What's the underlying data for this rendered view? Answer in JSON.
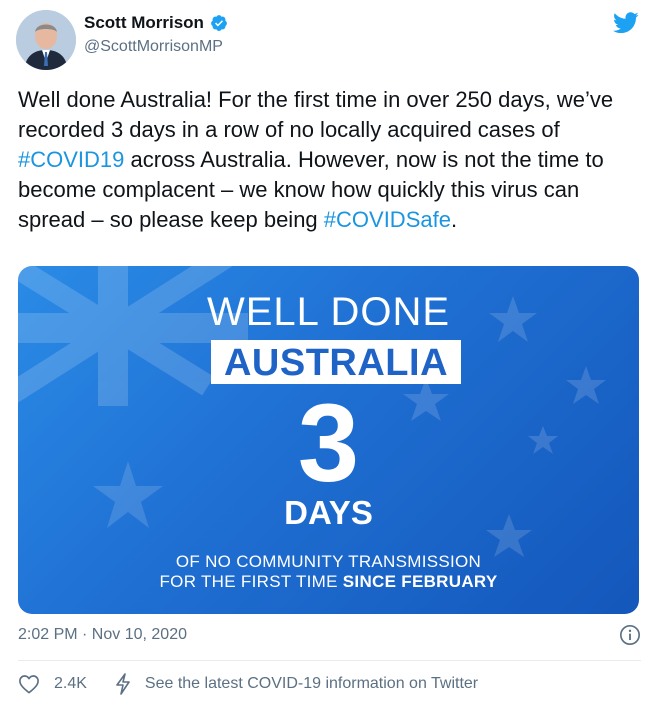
{
  "author": {
    "display_name": "Scott Morrison",
    "handle": "@ScottMorrisonMP",
    "verified": true
  },
  "tweet": {
    "text_part1": "Well done Australia! For the first time in over 250 days, we’ve recorded 3 days in a row of no locally acquired cases of ",
    "hashtag1": "#COVID19",
    "text_part2": " across Australia. However, now is not the time to become complacent – we know how quickly this virus can spread – so please keep being ",
    "hashtag2": "#COVIDSafe",
    "text_part3": "."
  },
  "media": {
    "line1": "WELL DONE",
    "line2": "AUSTRALIA",
    "number": "3",
    "days": "DAYS",
    "sub1": "OF NO COMMUNITY TRANSMISSION",
    "sub2_prefix": "FOR THE FIRST TIME ",
    "sub2_bold": "SINCE FEBRUARY"
  },
  "meta": {
    "timestamp": "2:02 PM · Nov 10, 2020"
  },
  "actions": {
    "likes": "2.4K",
    "covid_link": "See the latest COVID-19 information on Twitter"
  },
  "icons": {
    "verified": "verified-badge-icon",
    "brand": "twitter-bird-icon",
    "info": "info-icon",
    "like": "heart-icon",
    "covid": "lightning-icon"
  },
  "colors": {
    "link": "#1b95e0",
    "brand": "#1da1f2",
    "secondary_text": "#5b7083",
    "media_blue": "#1f6fd2"
  }
}
